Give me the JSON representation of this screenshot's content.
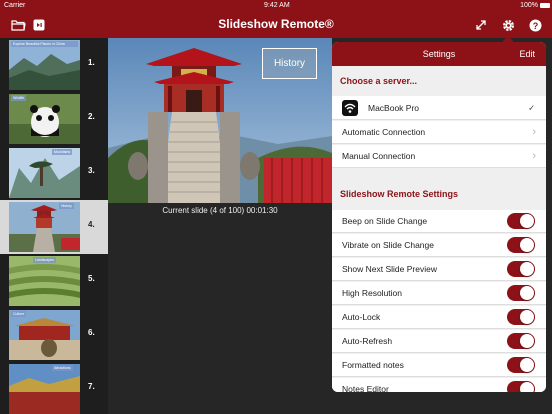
{
  "status_bar": {
    "carrier": "Carrier",
    "time": "9:42 AM",
    "battery": "100%"
  },
  "nav": {
    "title": "Slideshow Remote®"
  },
  "slides": [
    {
      "num": "1.",
      "label": "Explore Beautiful Places in China"
    },
    {
      "num": "2.",
      "label": "Wildlife"
    },
    {
      "num": "3.",
      "label": "Mountains"
    },
    {
      "num": "4.",
      "label": "History"
    },
    {
      "num": "5.",
      "label": "Landscapes"
    },
    {
      "num": "6.",
      "label": "Culture"
    },
    {
      "num": "7.",
      "label": "Attractions"
    }
  ],
  "main": {
    "overlay_label": "History",
    "caption": "Current slide (4 of 100) 00:01:30"
  },
  "settings": {
    "title": "Settings",
    "edit_label": "Edit",
    "server_section": "Choose a server...",
    "servers": [
      {
        "label": "MacBook Pro"
      },
      {
        "label": "Automatic Connection"
      },
      {
        "label": "Manual Connection"
      }
    ],
    "remote_section": "Slideshow Remote Settings",
    "toggles": [
      {
        "label": "Beep on Slide Change",
        "on": true
      },
      {
        "label": "Vibrate on Slide Change",
        "on": true
      },
      {
        "label": "Show Next Slide Preview",
        "on": true
      },
      {
        "label": "High Resolution",
        "on": true
      },
      {
        "label": "Auto-Lock",
        "on": true
      },
      {
        "label": "Auto-Refresh",
        "on": true
      },
      {
        "label": "Formatted notes",
        "on": true
      },
      {
        "label": "Notes Editor",
        "on": true
      }
    ]
  },
  "colors": {
    "accent": "#8c1217",
    "background": "#262626"
  },
  "icons": [
    "folder-icon",
    "screen-icon",
    "expand-icon",
    "gear-icon",
    "help-icon",
    "wifi-icon",
    "checkmark-icon",
    "chevron-right-icon"
  ]
}
